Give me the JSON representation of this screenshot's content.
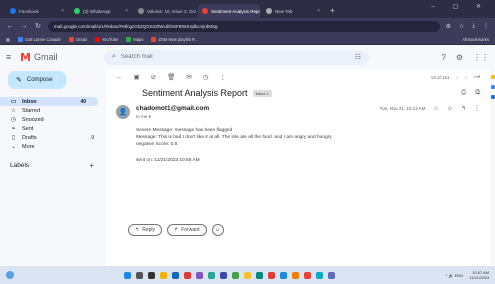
{
  "browser": {
    "tabs": [
      {
        "label": "Facebook",
        "color": "#1877f2",
        "active": false
      },
      {
        "label": "(3) WhatsApp",
        "color": "#25d366",
        "active": false
      },
      {
        "label": "Volume: 10, Issue 3, October",
        "color": "#888888",
        "active": false
      },
      {
        "label": "Sentiment Analysis Report - chadomot1@gmail.com - Gmail",
        "color": "#ea4335",
        "active": true
      },
      {
        "label": "New Tab",
        "color": "#aaaaaa",
        "active": false
      }
    ],
    "new_tab_glyph": "+",
    "url": "mail.google.com/mail/u/1/#inbox/FMfcgzGkZQGSnZtWcdkhSFBWJHplkcmjrdMSg",
    "bookmarks": [
      {
        "label": "Gail Lanne Casade",
        "color": "#4285f4"
      },
      {
        "label": "Gmail",
        "color": "#ea4335"
      },
      {
        "label": "YouTube",
        "color": "#ff0000"
      },
      {
        "label": "Maps",
        "color": "#34a853"
      },
      {
        "label": "ZSM New playlist P...",
        "color": "#ea4335"
      }
    ],
    "bookmarks_right": "All Bookmarks"
  },
  "gmail": {
    "app_name": "Gmail",
    "search_placeholder": "Search mail",
    "compose_label": "Compose",
    "nav": [
      {
        "label": "Inbox",
        "icon": "inbox-icon",
        "glyph": "▭",
        "count": "40",
        "active": true
      },
      {
        "label": "Starred",
        "icon": "star-icon",
        "glyph": "☆",
        "count": "",
        "active": false
      },
      {
        "label": "Snoozed",
        "icon": "clock-icon",
        "glyph": "◷",
        "count": "",
        "active": false
      },
      {
        "label": "Sent",
        "icon": "send-icon",
        "glyph": "➢",
        "count": "",
        "active": false
      },
      {
        "label": "Drafts",
        "icon": "draft-icon",
        "glyph": "▯",
        "count": "9",
        "active": false
      },
      {
        "label": "More",
        "icon": "chevron-down-icon",
        "glyph": "⌄",
        "count": "",
        "active": false
      }
    ],
    "labels_heading": "Labels",
    "pager": "13 of 161"
  },
  "email": {
    "subject": "Sentiment Analysis Report",
    "chip": "Inbox ×",
    "sender": "chadomot1@gmail.com",
    "to_me": "to me ▾",
    "date": "Tue, Nov 21, 10:13 AM",
    "body_line1": "Severe Message: message has been flagged",
    "body_line2": "Message: This is bad I don't like it at all. The site ate all the food. and I am angry and hungry",
    "body_line3": "negative Score: 0.8",
    "sent_on": "sent on: 11/21/2023 10:55 AM",
    "reply_label": "Reply",
    "forward_label": "Forward"
  },
  "taskbar": {
    "apps": [
      "#1e88e5",
      "#555555",
      "#333333",
      "#f4b400",
      "#1565c0",
      "#e53935",
      "#7e57c2",
      "#26a69a",
      "#3949ab",
      "#43a047",
      "#fbc02d",
      "#00897b",
      "#e53935",
      "#1e88e5",
      "#f57c00",
      "#ea4335",
      "#00acc1",
      "#5c6bc0"
    ],
    "tray": "^ 🔊 ENG",
    "time": "10:57 AM",
    "date": "11/21/2023"
  }
}
